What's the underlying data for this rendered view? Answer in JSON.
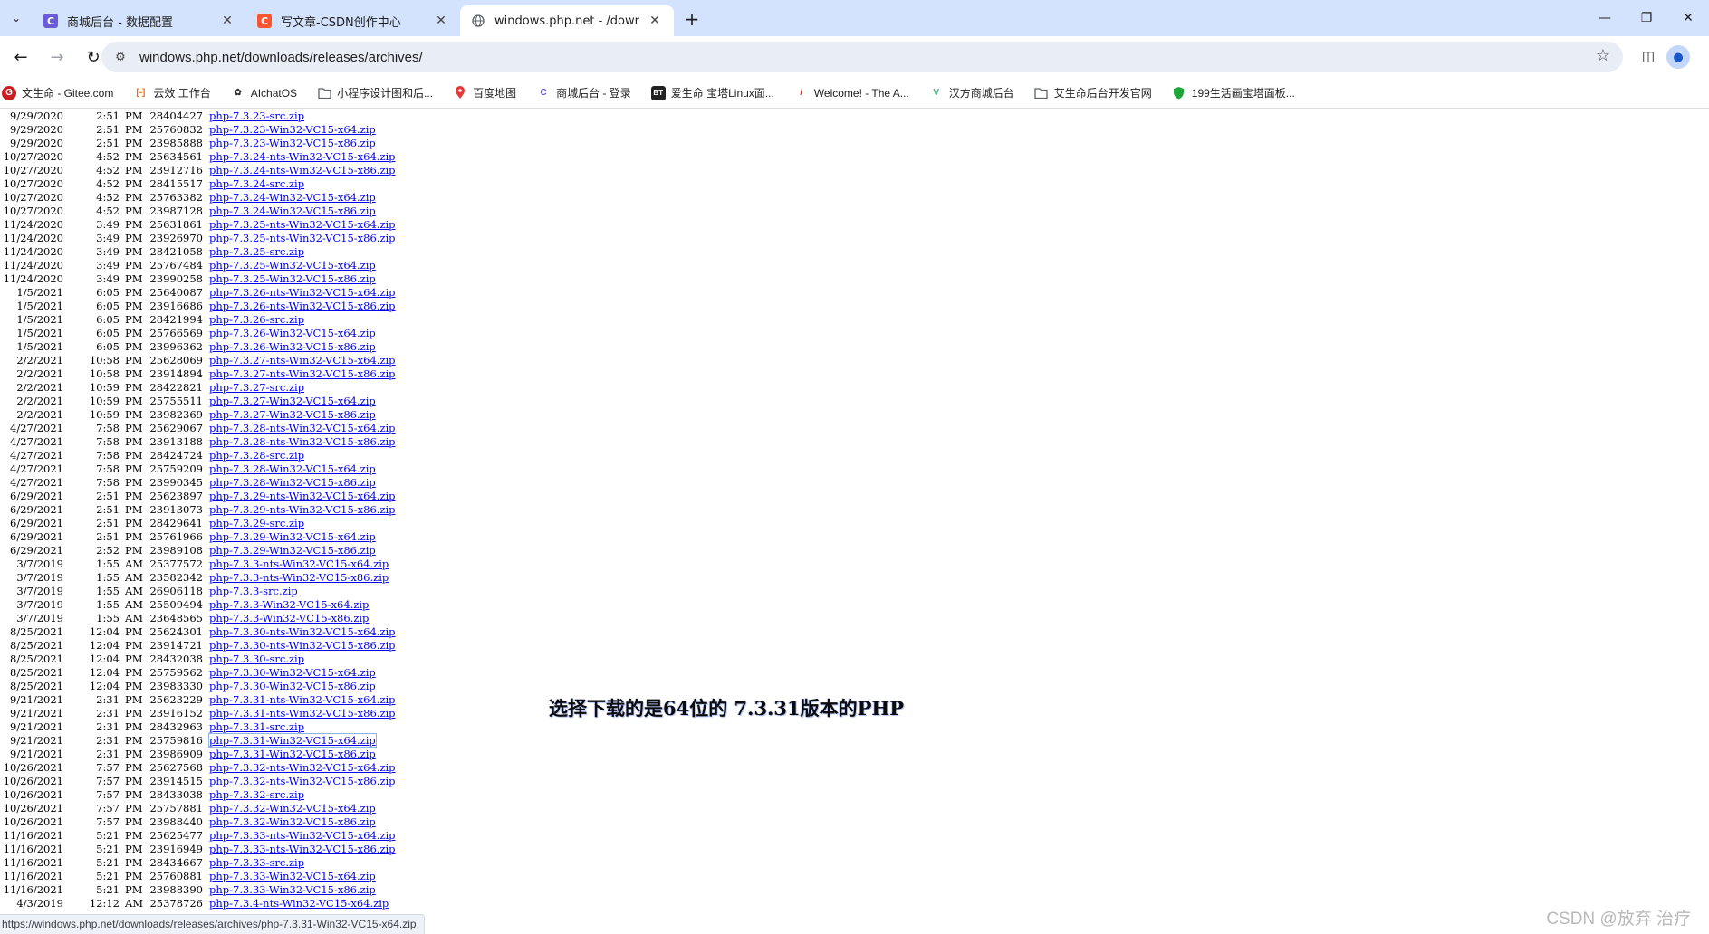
{
  "browser": {
    "tabs": [
      {
        "title": "商城后台 - 数据配置",
        "favicon": "C",
        "favicon_color": "#6a5bd6",
        "active": false
      },
      {
        "title": "写文章-CSDN创作中心",
        "favicon": "C",
        "favicon_color": "#fc5531",
        "active": false
      },
      {
        "title": "windows.php.net - /downloa",
        "favicon": "globe-icon",
        "favicon_color": "#5f6368",
        "active": true
      }
    ],
    "new_tab": "+",
    "url": "windows.php.net/downloads/releases/archives/",
    "bookmarks": [
      {
        "label": "文生命 - Gitee.com",
        "icon": "G",
        "color": "#c71d23"
      },
      {
        "label": "云效 工作台",
        "icon": "[-]",
        "color": "#ff6a00"
      },
      {
        "label": "AIchatOS",
        "icon": "✿",
        "color": "#333333"
      },
      {
        "label": "小程序设计图和后...",
        "icon": "folder-icon",
        "color": "#5f6368"
      },
      {
        "label": "百度地图",
        "icon": "pin-icon",
        "color": "#e53935"
      },
      {
        "label": "商城后台 - 登录",
        "icon": "C",
        "color": "#6a5bd6"
      },
      {
        "label": "爱生命 宝塔Linux面...",
        "icon": "BT",
        "color": "#222222"
      },
      {
        "label": "Welcome! - The A...",
        "icon": "/",
        "color": "#d32f2f"
      },
      {
        "label": "汉方商城后台",
        "icon": "V",
        "color": "#42b883"
      },
      {
        "label": "艾生命后台开发官网",
        "icon": "folder-icon",
        "color": "#5f6368"
      },
      {
        "label": "199生活画宝塔面板...",
        "icon": "shield-icon",
        "color": "#20a53a"
      }
    ]
  },
  "listing": [
    {
      "date": "9/29/2020",
      "time": "2:51",
      "ampm": "PM",
      "size": "28404427",
      "file": "php-7.3.23-src.zip"
    },
    {
      "date": "9/29/2020",
      "time": "2:51",
      "ampm": "PM",
      "size": "25760832",
      "file": "php-7.3.23-Win32-VC15-x64.zip"
    },
    {
      "date": "9/29/2020",
      "time": "2:51",
      "ampm": "PM",
      "size": "23985888",
      "file": "php-7.3.23-Win32-VC15-x86.zip"
    },
    {
      "date": "10/27/2020",
      "time": "4:52",
      "ampm": "PM",
      "size": "25634561",
      "file": "php-7.3.24-nts-Win32-VC15-x64.zip"
    },
    {
      "date": "10/27/2020",
      "time": "4:52",
      "ampm": "PM",
      "size": "23912716",
      "file": "php-7.3.24-nts-Win32-VC15-x86.zip"
    },
    {
      "date": "10/27/2020",
      "time": "4:52",
      "ampm": "PM",
      "size": "28415517",
      "file": "php-7.3.24-src.zip"
    },
    {
      "date": "10/27/2020",
      "time": "4:52",
      "ampm": "PM",
      "size": "25763382",
      "file": "php-7.3.24-Win32-VC15-x64.zip"
    },
    {
      "date": "10/27/2020",
      "time": "4:52",
      "ampm": "PM",
      "size": "23987128",
      "file": "php-7.3.24-Win32-VC15-x86.zip"
    },
    {
      "date": "11/24/2020",
      "time": "3:49",
      "ampm": "PM",
      "size": "25631861",
      "file": "php-7.3.25-nts-Win32-VC15-x64.zip"
    },
    {
      "date": "11/24/2020",
      "time": "3:49",
      "ampm": "PM",
      "size": "23926970",
      "file": "php-7.3.25-nts-Win32-VC15-x86.zip"
    },
    {
      "date": "11/24/2020",
      "time": "3:49",
      "ampm": "PM",
      "size": "28421058",
      "file": "php-7.3.25-src.zip"
    },
    {
      "date": "11/24/2020",
      "time": "3:49",
      "ampm": "PM",
      "size": "25767484",
      "file": "php-7.3.25-Win32-VC15-x64.zip"
    },
    {
      "date": "11/24/2020",
      "time": "3:49",
      "ampm": "PM",
      "size": "23990258",
      "file": "php-7.3.25-Win32-VC15-x86.zip"
    },
    {
      "date": "1/5/2021",
      "time": "6:05",
      "ampm": "PM",
      "size": "25640087",
      "file": "php-7.3.26-nts-Win32-VC15-x64.zip"
    },
    {
      "date": "1/5/2021",
      "time": "6:05",
      "ampm": "PM",
      "size": "23916686",
      "file": "php-7.3.26-nts-Win32-VC15-x86.zip"
    },
    {
      "date": "1/5/2021",
      "time": "6:05",
      "ampm": "PM",
      "size": "28421994",
      "file": "php-7.3.26-src.zip"
    },
    {
      "date": "1/5/2021",
      "time": "6:05",
      "ampm": "PM",
      "size": "25766569",
      "file": "php-7.3.26-Win32-VC15-x64.zip"
    },
    {
      "date": "1/5/2021",
      "time": "6:05",
      "ampm": "PM",
      "size": "23996362",
      "file": "php-7.3.26-Win32-VC15-x86.zip"
    },
    {
      "date": "2/2/2021",
      "time": "10:58",
      "ampm": "PM",
      "size": "25628069",
      "file": "php-7.3.27-nts-Win32-VC15-x64.zip"
    },
    {
      "date": "2/2/2021",
      "time": "10:58",
      "ampm": "PM",
      "size": "23914894",
      "file": "php-7.3.27-nts-Win32-VC15-x86.zip"
    },
    {
      "date": "2/2/2021",
      "time": "10:59",
      "ampm": "PM",
      "size": "28422821",
      "file": "php-7.3.27-src.zip"
    },
    {
      "date": "2/2/2021",
      "time": "10:59",
      "ampm": "PM",
      "size": "25755511",
      "file": "php-7.3.27-Win32-VC15-x64.zip"
    },
    {
      "date": "2/2/2021",
      "time": "10:59",
      "ampm": "PM",
      "size": "23982369",
      "file": "php-7.3.27-Win32-VC15-x86.zip"
    },
    {
      "date": "4/27/2021",
      "time": "7:58",
      "ampm": "PM",
      "size": "25629067",
      "file": "php-7.3.28-nts-Win32-VC15-x64.zip"
    },
    {
      "date": "4/27/2021",
      "time": "7:58",
      "ampm": "PM",
      "size": "23913188",
      "file": "php-7.3.28-nts-Win32-VC15-x86.zip"
    },
    {
      "date": "4/27/2021",
      "time": "7:58",
      "ampm": "PM",
      "size": "28424724",
      "file": "php-7.3.28-src.zip"
    },
    {
      "date": "4/27/2021",
      "time": "7:58",
      "ampm": "PM",
      "size": "25759209",
      "file": "php-7.3.28-Win32-VC15-x64.zip"
    },
    {
      "date": "4/27/2021",
      "time": "7:58",
      "ampm": "PM",
      "size": "23990345",
      "file": "php-7.3.28-Win32-VC15-x86.zip"
    },
    {
      "date": "6/29/2021",
      "time": "2:51",
      "ampm": "PM",
      "size": "25623897",
      "file": "php-7.3.29-nts-Win32-VC15-x64.zip"
    },
    {
      "date": "6/29/2021",
      "time": "2:51",
      "ampm": "PM",
      "size": "23913073",
      "file": "php-7.3.29-nts-Win32-VC15-x86.zip"
    },
    {
      "date": "6/29/2021",
      "time": "2:51",
      "ampm": "PM",
      "size": "28429641",
      "file": "php-7.3.29-src.zip"
    },
    {
      "date": "6/29/2021",
      "time": "2:51",
      "ampm": "PM",
      "size": "25761966",
      "file": "php-7.3.29-Win32-VC15-x64.zip"
    },
    {
      "date": "6/29/2021",
      "time": "2:52",
      "ampm": "PM",
      "size": "23989108",
      "file": "php-7.3.29-Win32-VC15-x86.zip"
    },
    {
      "date": "3/7/2019",
      "time": "1:55",
      "ampm": "AM",
      "size": "25377572",
      "file": "php-7.3.3-nts-Win32-VC15-x64.zip"
    },
    {
      "date": "3/7/2019",
      "time": "1:55",
      "ampm": "AM",
      "size": "23582342",
      "file": "php-7.3.3-nts-Win32-VC15-x86.zip"
    },
    {
      "date": "3/7/2019",
      "time": "1:55",
      "ampm": "AM",
      "size": "26906118",
      "file": "php-7.3.3-src.zip"
    },
    {
      "date": "3/7/2019",
      "time": "1:55",
      "ampm": "AM",
      "size": "25509494",
      "file": "php-7.3.3-Win32-VC15-x64.zip"
    },
    {
      "date": "3/7/2019",
      "time": "1:55",
      "ampm": "AM",
      "size": "23648565",
      "file": "php-7.3.3-Win32-VC15-x86.zip"
    },
    {
      "date": "8/25/2021",
      "time": "12:04",
      "ampm": "PM",
      "size": "25624301",
      "file": "php-7.3.30-nts-Win32-VC15-x64.zip"
    },
    {
      "date": "8/25/2021",
      "time": "12:04",
      "ampm": "PM",
      "size": "23914721",
      "file": "php-7.3.30-nts-Win32-VC15-x86.zip"
    },
    {
      "date": "8/25/2021",
      "time": "12:04",
      "ampm": "PM",
      "size": "28432038",
      "file": "php-7.3.30-src.zip"
    },
    {
      "date": "8/25/2021",
      "time": "12:04",
      "ampm": "PM",
      "size": "25759562",
      "file": "php-7.3.30-Win32-VC15-x64.zip"
    },
    {
      "date": "8/25/2021",
      "time": "12:04",
      "ampm": "PM",
      "size": "23983330",
      "file": "php-7.3.30-Win32-VC15-x86.zip"
    },
    {
      "date": "9/21/2021",
      "time": "2:31",
      "ampm": "PM",
      "size": "25623229",
      "file": "php-7.3.31-nts-Win32-VC15-x64.zip"
    },
    {
      "date": "9/21/2021",
      "time": "2:31",
      "ampm": "PM",
      "size": "23916152",
      "file": "php-7.3.31-nts-Win32-VC15-x86.zip"
    },
    {
      "date": "9/21/2021",
      "time": "2:31",
      "ampm": "PM",
      "size": "28432963",
      "file": "php-7.3.31-src.zip"
    },
    {
      "date": "9/21/2021",
      "time": "2:31",
      "ampm": "PM",
      "size": "25759816",
      "file": "php-7.3.31-Win32-VC15-x64.zip",
      "focused": true
    },
    {
      "date": "9/21/2021",
      "time": "2:31",
      "ampm": "PM",
      "size": "23986909",
      "file": "php-7.3.31-Win32-VC15-x86.zip"
    },
    {
      "date": "10/26/2021",
      "time": "7:57",
      "ampm": "PM",
      "size": "25627568",
      "file": "php-7.3.32-nts-Win32-VC15-x64.zip"
    },
    {
      "date": "10/26/2021",
      "time": "7:57",
      "ampm": "PM",
      "size": "23914515",
      "file": "php-7.3.32-nts-Win32-VC15-x86.zip"
    },
    {
      "date": "10/26/2021",
      "time": "7:57",
      "ampm": "PM",
      "size": "28433038",
      "file": "php-7.3.32-src.zip"
    },
    {
      "date": "10/26/2021",
      "time": "7:57",
      "ampm": "PM",
      "size": "25757881",
      "file": "php-7.3.32-Win32-VC15-x64.zip"
    },
    {
      "date": "10/26/2021",
      "time": "7:57",
      "ampm": "PM",
      "size": "23988440",
      "file": "php-7.3.32-Win32-VC15-x86.zip"
    },
    {
      "date": "11/16/2021",
      "time": "5:21",
      "ampm": "PM",
      "size": "25625477",
      "file": "php-7.3.33-nts-Win32-VC15-x64.zip"
    },
    {
      "date": "11/16/2021",
      "time": "5:21",
      "ampm": "PM",
      "size": "23916949",
      "file": "php-7.3.33-nts-Win32-VC15-x86.zip"
    },
    {
      "date": "11/16/2021",
      "time": "5:21",
      "ampm": "PM",
      "size": "28434667",
      "file": "php-7.3.33-src.zip"
    },
    {
      "date": "11/16/2021",
      "time": "5:21",
      "ampm": "PM",
      "size": "25760881",
      "file": "php-7.3.33-Win32-VC15-x64.zip"
    },
    {
      "date": "11/16/2021",
      "time": "5:21",
      "ampm": "PM",
      "size": "23988390",
      "file": "php-7.3.33-Win32-VC15-x86.zip"
    },
    {
      "date": "4/3/2019",
      "time": "12:12",
      "ampm": "AM",
      "size": "25378726",
      "file": "php-7.3.4-nts-Win32-VC15-x64.zip"
    }
  ],
  "annotation": "选择下载的是64位的 7.3.31版本的PHP",
  "status_url": "https://windows.php.net/downloads/releases/archives/php-7.3.31-Win32-VC15-x64.zip",
  "watermark": "CSDN @放弃      治疗"
}
